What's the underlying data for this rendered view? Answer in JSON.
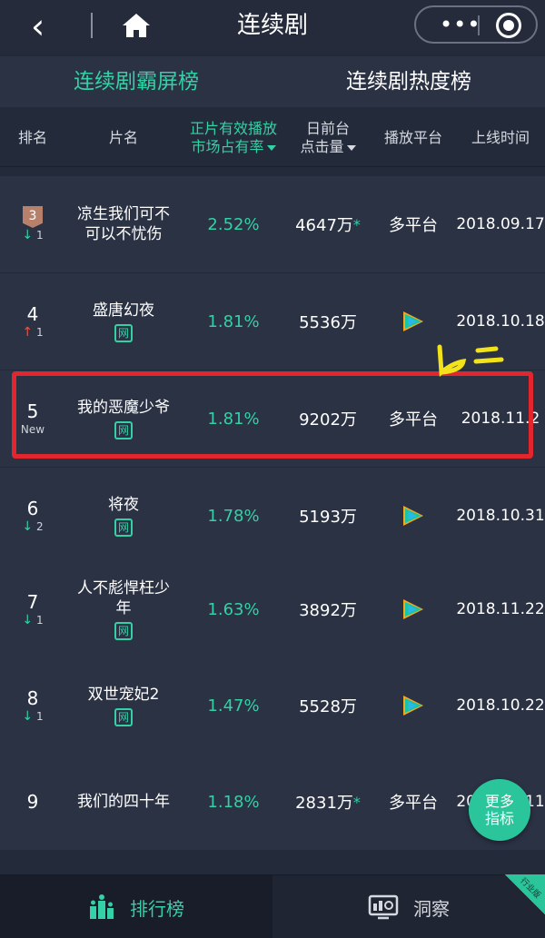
{
  "topbar": {
    "title": "连续剧"
  },
  "tabs": {
    "active": "连续剧霸屏榜",
    "inactive": "连续剧热度榜"
  },
  "header": {
    "rank": "排名",
    "name": "片名",
    "share_l1": "正片有效播放",
    "share_l2": "市场占有率",
    "clicks_l1": "日前台",
    "clicks_l2": "点击量",
    "platform": "播放平台",
    "date": "上线时间"
  },
  "rows": [
    {
      "rank": "3",
      "change": "1",
      "dir": "down",
      "name_l1": "凉生我们可不",
      "name_l2": "可以不忧伤",
      "tag": "",
      "share": "2.52%",
      "clicks": "4647万",
      "star": "*",
      "platform": "多平台",
      "platform_icon": "",
      "date": "2018.09.17"
    },
    {
      "rank": "4",
      "change": "1",
      "dir": "up",
      "name_l1": "盛唐幻夜",
      "name_l2": "",
      "tag": "网",
      "share": "1.81%",
      "clicks": "5536万",
      "star": "",
      "platform": "",
      "platform_icon": "tencent-video-icon",
      "date": "2018.10.18"
    },
    {
      "rank": "5",
      "change": "New",
      "dir": "new",
      "name_l1": "我的恶魔少爷",
      "name_l2": "",
      "tag": "网",
      "share": "1.81%",
      "clicks": "9202万",
      "star": "",
      "platform": "多平台",
      "platform_icon": "",
      "date": "2018.11.2"
    },
    {
      "rank": "6",
      "change": "2",
      "dir": "down",
      "name_l1": "将夜",
      "name_l2": "",
      "tag": "网",
      "share": "1.78%",
      "clicks": "5193万",
      "star": "",
      "platform": "",
      "platform_icon": "tencent-video-icon",
      "date": "2018.10.31"
    },
    {
      "rank": "7",
      "change": "1",
      "dir": "down",
      "name_l1": "人不彪悍枉少",
      "name_l2": "年",
      "tag": "网",
      "share": "1.63%",
      "clicks": "3892万",
      "star": "",
      "platform": "",
      "platform_icon": "tencent-video-icon",
      "date": "2018.11.22"
    },
    {
      "rank": "8",
      "change": "1",
      "dir": "down",
      "name_l1": "双世宠妃2",
      "name_l2": "",
      "tag": "网",
      "share": "1.47%",
      "clicks": "5528万",
      "star": "",
      "platform": "",
      "platform_icon": "tencent-video-icon",
      "date": "2018.10.22"
    },
    {
      "rank": "9",
      "change": "",
      "dir": "",
      "name_l1": "我们的四十年",
      "name_l2": "",
      "tag": "",
      "share": "1.18%",
      "clicks": "2831万",
      "star": "*",
      "platform": "多平台",
      "platform_icon": "",
      "date": "2018.11.11"
    }
  ],
  "more_button": {
    "l1": "更多",
    "l2": "指标"
  },
  "bottom": {
    "active": "排行榜",
    "inactive": "洞察",
    "corner": "行业版"
  },
  "colors": {
    "accent": "#34d0a6",
    "bg": "#232a3a",
    "row": "#2b3244",
    "highlight": "#e1262e",
    "medal": "#b7806a"
  }
}
